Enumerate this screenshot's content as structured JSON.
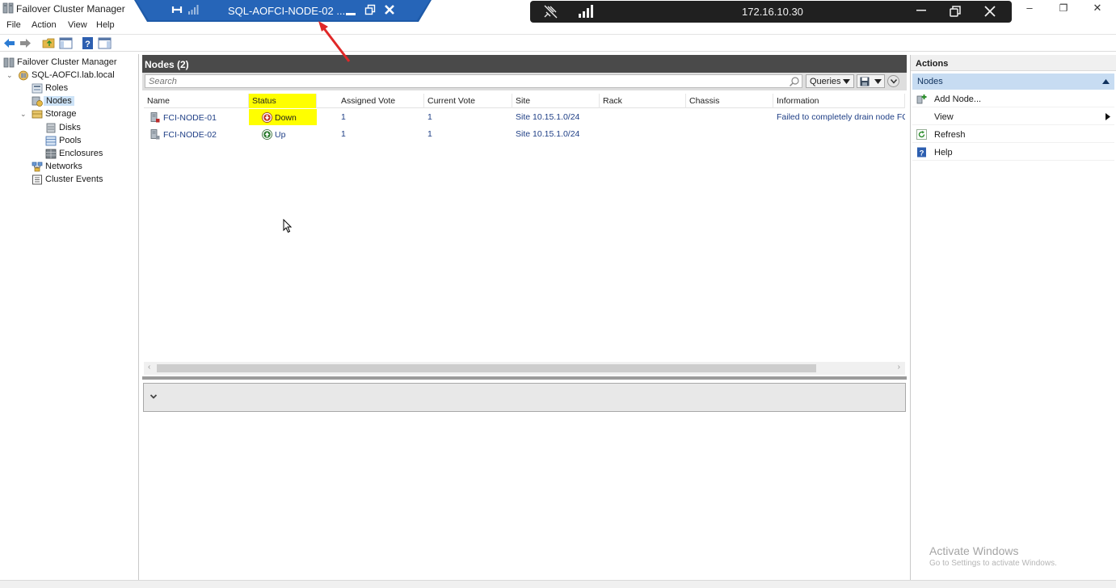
{
  "window": {
    "title": "Failover Cluster Manager",
    "minimize": "–",
    "maximize": "❐",
    "close": "✕"
  },
  "menu": [
    "File",
    "Action",
    "View",
    "Help"
  ],
  "tree": {
    "root": "Failover Cluster Manager",
    "cluster": "SQL-AOFCI.lab.local",
    "roles": "Roles",
    "nodes": "Nodes",
    "storage": "Storage",
    "disks": "Disks",
    "pools": "Pools",
    "enclosures": "Enclosures",
    "networks": "Networks",
    "events": "Cluster Events"
  },
  "center": {
    "title": "Nodes (2)",
    "search_placeholder": "Search",
    "queries_label": "Queries",
    "columns": [
      "Name",
      "Status",
      "Assigned Vote",
      "Current Vote",
      "Site",
      "Rack",
      "Chassis",
      "Information"
    ],
    "rows": [
      {
        "name": "FCI-NODE-01",
        "status": "Down",
        "status_kind": "down",
        "assigned_vote": "1",
        "current_vote": "1",
        "site": "Site 10.15.1.0/24",
        "rack": "",
        "chassis": "",
        "information": "Failed to completely drain node FCI"
      },
      {
        "name": "FCI-NODE-02",
        "status": "Up",
        "status_kind": "up",
        "assigned_vote": "1",
        "current_vote": "1",
        "site": "Site 10.15.1.0/24",
        "rack": "",
        "chassis": "",
        "information": ""
      }
    ],
    "status_colors": {
      "down": "#c0392b",
      "up": "#2e7d32"
    },
    "highlight_color": "#ffff00"
  },
  "actions": {
    "title": "Actions",
    "group": "Nodes",
    "items": [
      "Add Node...",
      "View",
      "Refresh",
      "Help"
    ]
  },
  "watermark": {
    "line1": "Activate Windows",
    "line2": "Go to Settings to activate Windows."
  },
  "rdp_bar": {
    "title": "SQL-AOFCI-NODE-02 ...",
    "color": "#1e5aa8"
  },
  "connection_bar": {
    "ip": "172.16.10.30"
  }
}
